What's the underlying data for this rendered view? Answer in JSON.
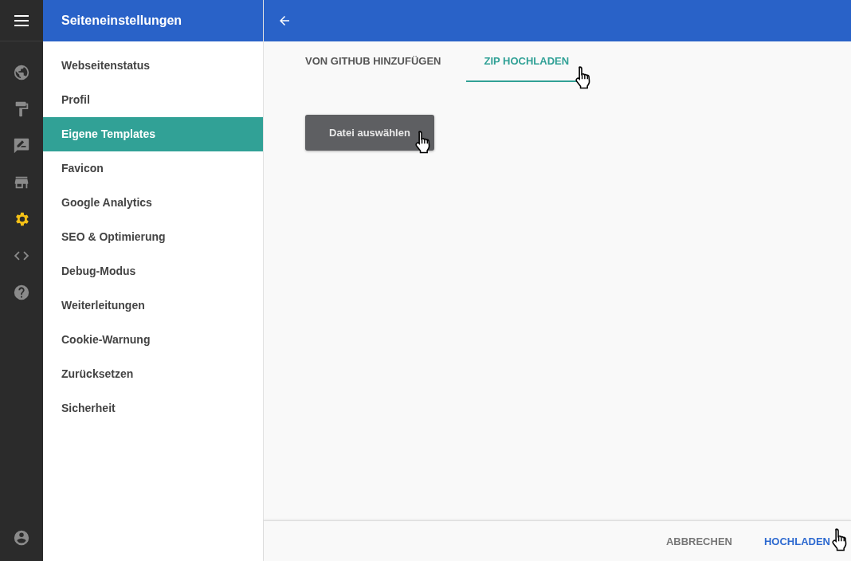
{
  "rail": {
    "items": [
      {
        "selected": false
      },
      {
        "selected": false
      },
      {
        "selected": false
      },
      {
        "selected": false
      },
      {
        "selected": true
      },
      {
        "selected": false
      },
      {
        "selected": false
      }
    ]
  },
  "sidebar": {
    "title": "Seiteneinstellungen",
    "items": [
      {
        "label": "Webseitenstatus",
        "selected": false
      },
      {
        "label": "Profil",
        "selected": false
      },
      {
        "label": "Eigene Templates",
        "selected": true
      },
      {
        "label": "Favicon",
        "selected": false
      },
      {
        "label": "Google Analytics",
        "selected": false
      },
      {
        "label": "SEO & Optimierung",
        "selected": false
      },
      {
        "label": "Debug-Modus",
        "selected": false
      },
      {
        "label": "Weiterleitungen",
        "selected": false
      },
      {
        "label": "Cookie-Warnung",
        "selected": false
      },
      {
        "label": "Zurücksetzen",
        "selected": false
      },
      {
        "label": "Sicherheit",
        "selected": false
      }
    ]
  },
  "tabs": [
    {
      "label": "VON GITHUB HINZUFÜGEN",
      "selected": false
    },
    {
      "label": "ZIP HOCHLADEN",
      "selected": true
    }
  ],
  "file_button": "Datei auswählen",
  "footer": {
    "buttons": [
      {
        "label": "ABBRECHEN",
        "kind": "plain"
      },
      {
        "label": "HOCHLADEN",
        "kind": "primary"
      }
    ]
  }
}
